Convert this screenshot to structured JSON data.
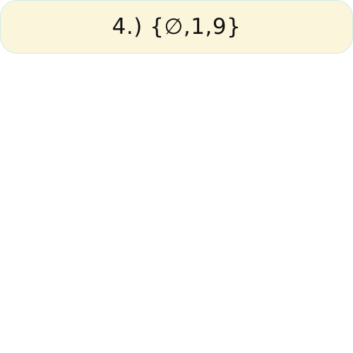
{
  "option": {
    "label": "4.) {∅,1,9}"
  },
  "colors": {
    "option_background": "#fbf5dc",
    "option_border": "#cfeee6"
  }
}
